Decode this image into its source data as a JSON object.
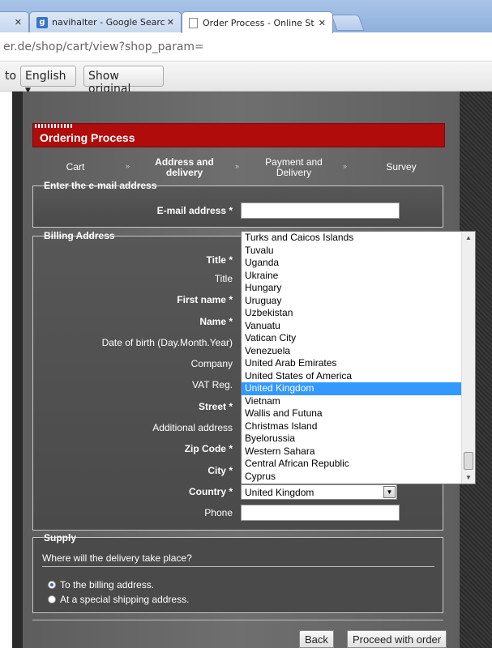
{
  "browser": {
    "tabs": [
      {
        "label": "navihalter - Google Search",
        "icon": "google-icon"
      },
      {
        "label": "Order Process - Online Store",
        "icon": "page-icon"
      }
    ],
    "url": "er.de/shop/cart/view?shop_param=",
    "translate": {
      "prefix": "to",
      "language": "English",
      "show_original": "Show original"
    }
  },
  "header": {
    "title": "Ordering Process"
  },
  "steps": [
    "Cart",
    "Address and delivery",
    "Payment and Delivery",
    "Survey"
  ],
  "email_section": {
    "legend": "Enter the e-mail address",
    "email_label": "E-mail address *"
  },
  "billing": {
    "legend": "Billing Address",
    "labels": {
      "title_req": "Title *",
      "title": "Title",
      "first_name": "First name *",
      "name": "Name *",
      "dob": "Date of birth (Day.Month.Year)",
      "company": "Company",
      "vat": "VAT Reg.",
      "street": "Street *",
      "additional": "Additional address",
      "zip": "Zip Code *",
      "city": "City *",
      "country": "Country *",
      "phone": "Phone"
    },
    "country_value": "United Kingdom",
    "country_options": [
      "Turks and Caicos Islands",
      "Tuvalu",
      "Uganda",
      "Ukraine",
      "Hungary",
      "Uruguay",
      "Uzbekistan",
      "Vanuatu",
      "Vatican City",
      "Venezuela",
      "United Arab Emirates",
      "United States of America",
      "United Kingdom",
      "Vietnam",
      "Wallis and Futuna",
      "Christmas Island",
      "Byelorussia",
      "Western Sahara",
      "Central African Republic",
      "Cyprus"
    ]
  },
  "supply": {
    "legend": "Supply",
    "question": "Where will the delivery take place?",
    "options": [
      "To the billing address.",
      "At a special shipping address."
    ]
  },
  "buttons": {
    "back": "Back",
    "proceed": "Proceed with order"
  }
}
